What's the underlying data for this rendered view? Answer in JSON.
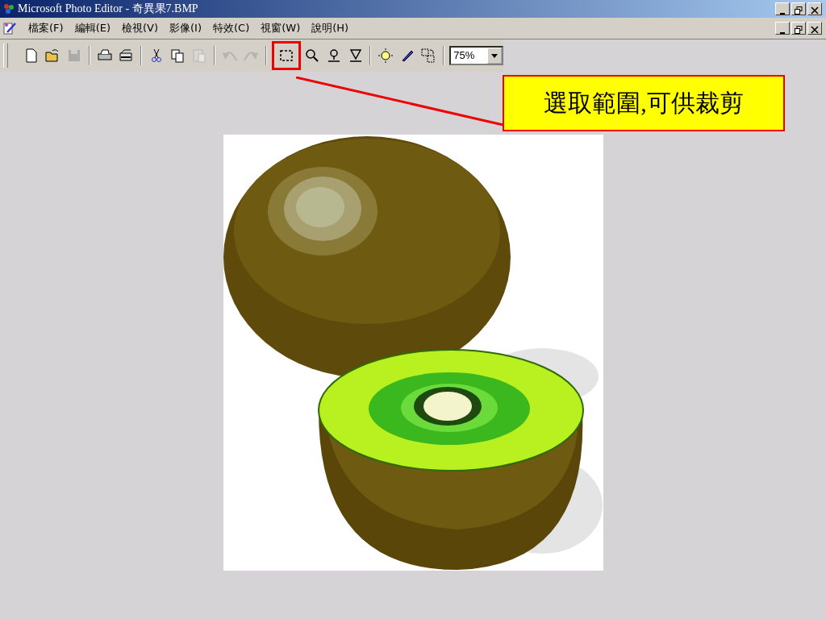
{
  "window": {
    "title": "Microsoft Photo Editor - 奇異果7.BMP"
  },
  "menu": [
    "檔案(F)",
    "編輯(E)",
    "檢視(V)",
    "影像(I)",
    "特效(C)",
    "視窗(W)",
    "說明(H)"
  ],
  "toolbar": [
    {
      "kind": "new",
      "disabled": false,
      "highlighted": false
    },
    {
      "kind": "open",
      "disabled": false,
      "highlighted": false
    },
    {
      "kind": "save",
      "disabled": true,
      "highlighted": false
    },
    {
      "kind": "separator"
    },
    {
      "kind": "print",
      "disabled": false,
      "highlighted": false
    },
    {
      "kind": "scan",
      "disabled": false,
      "highlighted": false
    },
    {
      "kind": "separator"
    },
    {
      "kind": "cut",
      "disabled": false,
      "highlighted": false
    },
    {
      "kind": "copy",
      "disabled": false,
      "highlighted": false
    },
    {
      "kind": "paste",
      "disabled": true,
      "highlighted": false
    },
    {
      "kind": "separator"
    },
    {
      "kind": "undo",
      "disabled": true,
      "highlighted": false
    },
    {
      "kind": "redo",
      "disabled": true,
      "highlighted": false
    },
    {
      "kind": "separator"
    },
    {
      "kind": "select",
      "disabled": false,
      "highlighted": true
    },
    {
      "kind": "zoom",
      "disabled": false,
      "highlighted": false
    },
    {
      "kind": "smudge",
      "disabled": false,
      "highlighted": false
    },
    {
      "kind": "sharpen",
      "disabled": false,
      "highlighted": false
    },
    {
      "kind": "separator"
    },
    {
      "kind": "balance",
      "disabled": false,
      "highlighted": false
    },
    {
      "kind": "pen",
      "disabled": false,
      "highlighted": false
    },
    {
      "kind": "rotate",
      "disabled": false,
      "highlighted": false
    }
  ],
  "zoom": {
    "value": "75%"
  },
  "callout": {
    "text": "選取範圍,可供裁剪"
  }
}
